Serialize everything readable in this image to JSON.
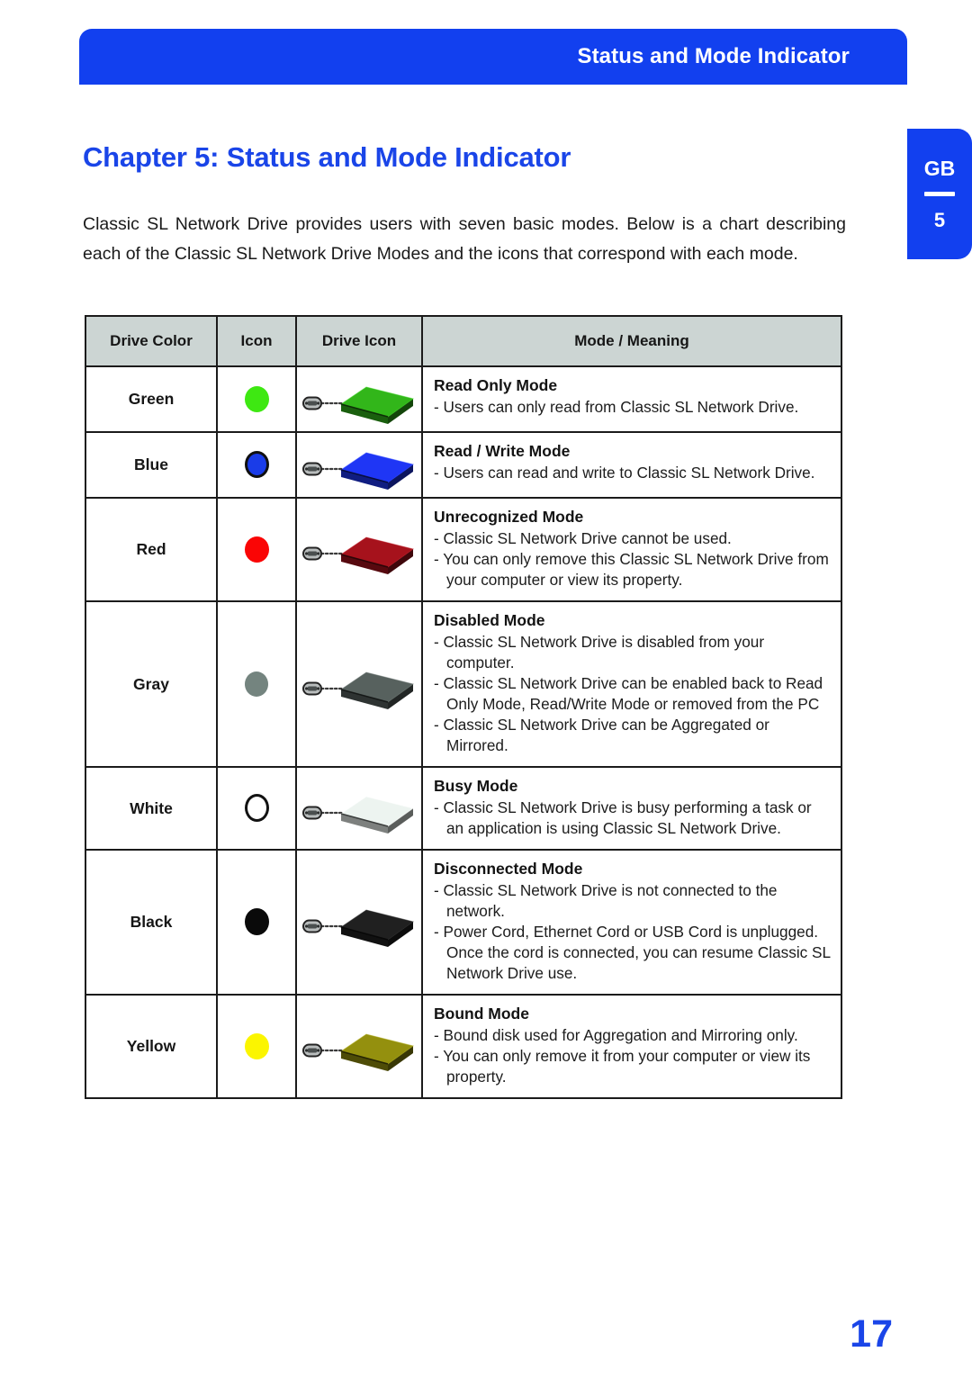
{
  "banner": {
    "title": "Status and Mode Indicator",
    "color": "#1240ef"
  },
  "side_tab": {
    "region": "GB",
    "chapter_number": "5"
  },
  "chapter": {
    "title": "Chapter 5: Status and Mode Indicator",
    "color": "#1a45e8"
  },
  "intro": {
    "paragraph": "Classic SL Network Drive provides users with seven basic modes. Below is a chart describing each of the Classic SL Network Drive Modes and the icons that correspond with each mode."
  },
  "table": {
    "headers": [
      "Drive Color",
      "Icon",
      "Drive Icon",
      "Mode / Meaning"
    ],
    "header_bg": "#ccd5d3",
    "rows": [
      {
        "color_label": "Green",
        "dot_color": "#3ee812",
        "drive_color": "#2a9a16",
        "mode_title": "Read Only Mode",
        "bullets": [
          "- Users can only read from Classic SL Network Drive."
        ]
      },
      {
        "color_label": "Blue",
        "dot_color": "#1a3ce8",
        "drive_color": "#1a2ed0",
        "mode_title": "Read / Write Mode",
        "bullets": [
          "- Users can read and write to Classic SL Network Drive."
        ]
      },
      {
        "color_label": "Red",
        "dot_color": "#fa0505",
        "drive_color": "#8d0f18",
        "mode_title": "Unrecognized Mode",
        "bullets": [
          "- Classic SL Network Drive cannot be used.",
          "- You can only remove this Classic SL Network Drive from your computer or view its property."
        ]
      },
      {
        "color_label": "Gray",
        "dot_color": "#74847f",
        "drive_color": "#4a5250",
        "mode_title": "Disabled Mode",
        "bullets": [
          "- Classic SL Network Drive is disabled from your computer.",
          "- Classic SL Network Drive can be enabled back to Read Only Mode, Read/Write Mode or removed from the PC",
          "- Classic SL Network Drive can be Aggregated or Mirrored."
        ]
      },
      {
        "color_label": "White",
        "dot_color": "#ffffff",
        "drive_color": "#c9cfcb",
        "mode_title": "Busy Mode",
        "bullets": [
          "- Classic SL Network Drive is busy performing a task or an application is using Classic SL Network Drive."
        ]
      },
      {
        "color_label": "Black",
        "dot_color": "#0a0a0a",
        "drive_color": "#1b1b1b",
        "mode_title": "Disconnected Mode",
        "bullets": [
          "- Classic SL Network Drive is not connected to the network.",
          "- Power Cord, Ethernet Cord or USB Cord is unplugged.  Once the cord is connected, you can resume Classic SL Network Drive use."
        ]
      },
      {
        "color_label": "Yellow",
        "dot_color": "#fbf500",
        "drive_color": "#7d7a0c",
        "mode_title": "Bound Mode",
        "bullets": [
          "- Bound disk used for Aggregation and Mirroring only.",
          "- You can only remove it from your computer or view its property."
        ]
      }
    ]
  },
  "footer": {
    "page_number": "17"
  }
}
